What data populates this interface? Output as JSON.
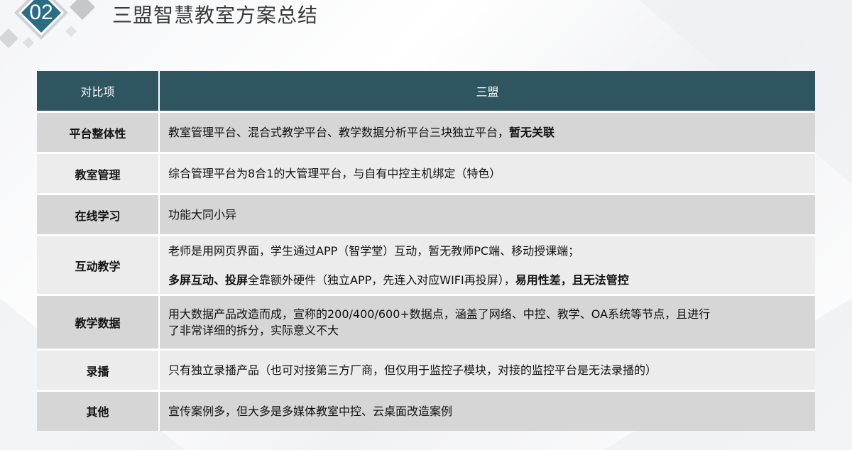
{
  "header": {
    "section_number": "02",
    "title": "三盟智慧教室方案总结"
  },
  "table": {
    "columns": [
      "对比项",
      "三盟"
    ],
    "rows": {
      "platform": {
        "item": "平台整体性",
        "desc_normal": "教室管理平台、混合式教学平台、教学数据分析平台三块独立平台，",
        "desc_bold": "暂无关联"
      },
      "classroom": {
        "item": "教室管理",
        "desc": "综合管理平台为8合1的大管理平台，与自有中控主机绑定（特色）"
      },
      "online": {
        "item": "在线学习",
        "desc": "功能大同小异"
      },
      "interactive": {
        "item": "互动教学",
        "desc_line1": "老师是用网页界面，学生通过APP（智学堂）互动，暂无教师PC端、移动授课端；",
        "desc_line2_bold_a": "多屏互动、投屏",
        "desc_line2_normal": "全靠额外硬件（独立APP，先连入对应WIFI再投屏），",
        "desc_line2_bold_b": "易用性差，且无法管控"
      },
      "data": {
        "item": "教学数据",
        "desc_line1": "用大数据产品改造而成，宣称的200/400/600+数据点，涵盖了网络、中控、教学、OA系统等节点，且进行",
        "desc_line2": "了非常详细的拆分，实际意义不大"
      },
      "recording": {
        "item": "录播",
        "desc": "只有独立录播产品（也可对接第三方厂商，但仅用于监控子模块，对接的监控平台是无法录播的）"
      },
      "other": {
        "item": "其他",
        "desc": "宣传案例多，但大多是多媒体教室中控、云桌面改造案例"
      }
    }
  },
  "colors": {
    "header_bg": "#2e5560",
    "badge": "#2a6d84",
    "row_dark": "#d6d6d6",
    "row_light": "#ececec"
  }
}
